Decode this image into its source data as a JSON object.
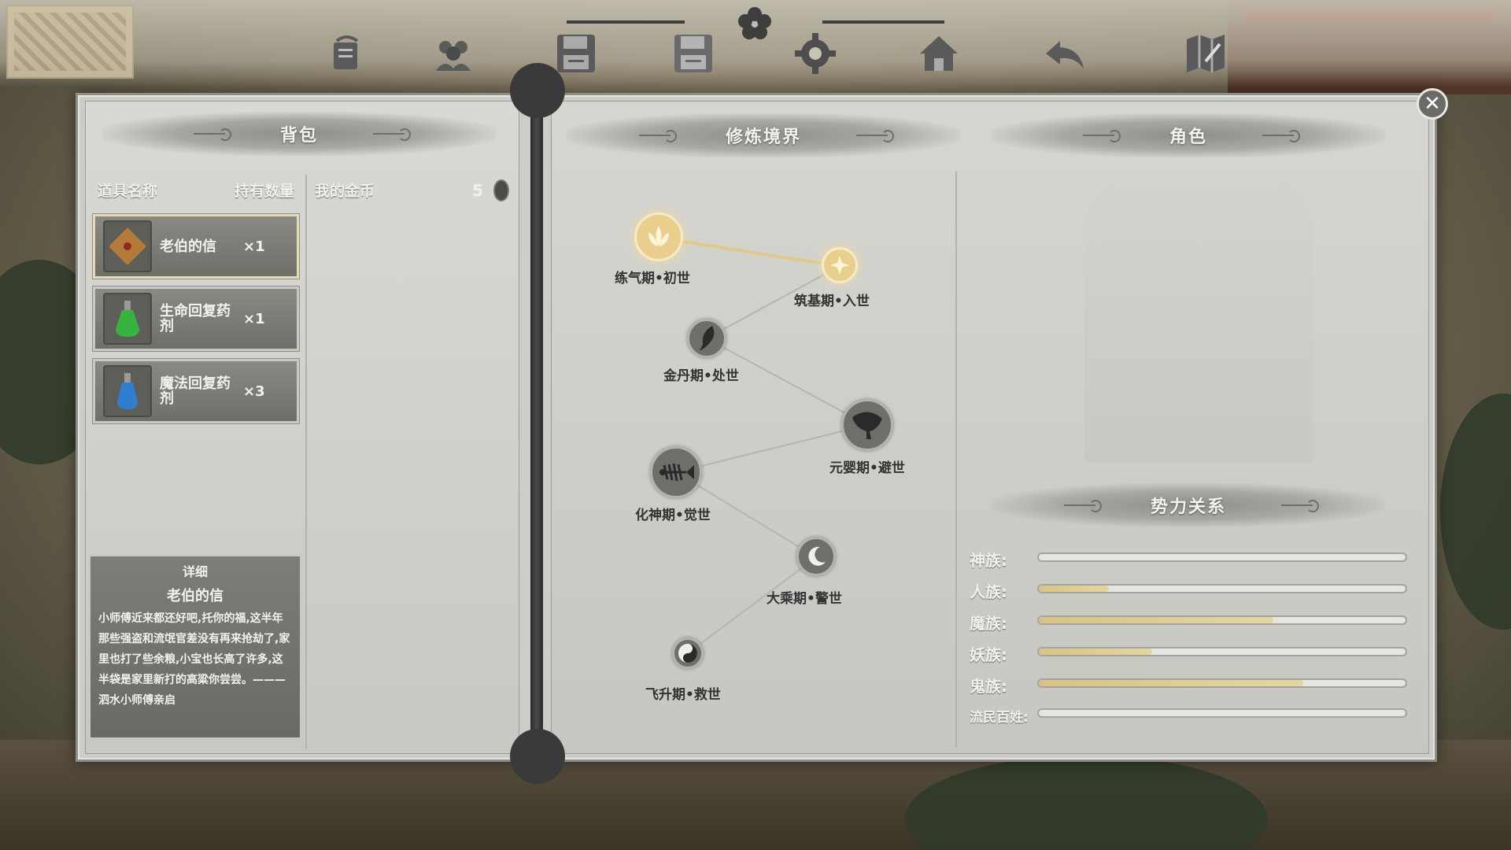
{
  "toolbar": {
    "buttons": [
      {
        "name": "quest-scroll-icon"
      },
      {
        "name": "party-icon"
      },
      {
        "name": "save-icon"
      },
      {
        "name": "load-icon"
      },
      {
        "name": "settings-gear-icon"
      },
      {
        "name": "home-icon"
      },
      {
        "name": "back-arrow-icon"
      },
      {
        "name": "map-icon"
      }
    ]
  },
  "inventory": {
    "title": "背包",
    "col_name": "道具名称",
    "col_qty": "持有数量",
    "gold_label": "我的金币",
    "gold_value": "5",
    "items": [
      {
        "name": "老伯的信",
        "qty": "×1",
        "icon": "letter-icon"
      },
      {
        "name": "生命回复药剂",
        "qty": "×1",
        "icon": "health-potion-icon"
      },
      {
        "name": "魔法回复药剂",
        "qty": "×3",
        "icon": "mana-potion-icon"
      }
    ],
    "detail": {
      "title": "详细",
      "item_name": "老伯的信",
      "text": "小师傅近来都还好吧,托你的福,这半年那些强盗和流氓官差没有再来抢劫了,家里也打了些余粮,小宝也长高了许多,这半袋是家里新打的高粱你尝尝。———泗水小师傅亲启"
    }
  },
  "realms": {
    "title": "修炼境界",
    "nodes": [
      {
        "label": "练气期•初世",
        "icon": "lotus-icon",
        "active": true
      },
      {
        "label": "筑基期•入世",
        "icon": "star-icon",
        "active": true
      },
      {
        "label": "金丹期•处世",
        "icon": "feather-icon",
        "active": false
      },
      {
        "label": "元婴期•避世",
        "icon": "ginkgo-leaf-icon",
        "active": false
      },
      {
        "label": "化神期•觉世",
        "icon": "fish-bone-icon",
        "active": false
      },
      {
        "label": "大乘期•警世",
        "icon": "crescent-moon-icon",
        "active": false
      },
      {
        "label": "飞升期•救世",
        "icon": "yin-yang-icon",
        "active": false
      }
    ]
  },
  "character": {
    "title": "角色"
  },
  "factions": {
    "title": "势力关系",
    "items": [
      {
        "label": "神族:",
        "value": 0.0
      },
      {
        "label": "人族:",
        "value": 0.19
      },
      {
        "label": "魔族:",
        "value": 0.64
      },
      {
        "label": "妖族:",
        "value": 0.31
      },
      {
        "label": "鬼族:",
        "value": 0.72
      },
      {
        "label": "流民百姓:",
        "value": 0.0
      }
    ]
  },
  "colors": {
    "accent_gold": "#e7d59d",
    "active_node": "#e8cf8e",
    "panel": "#cdcdc7"
  }
}
